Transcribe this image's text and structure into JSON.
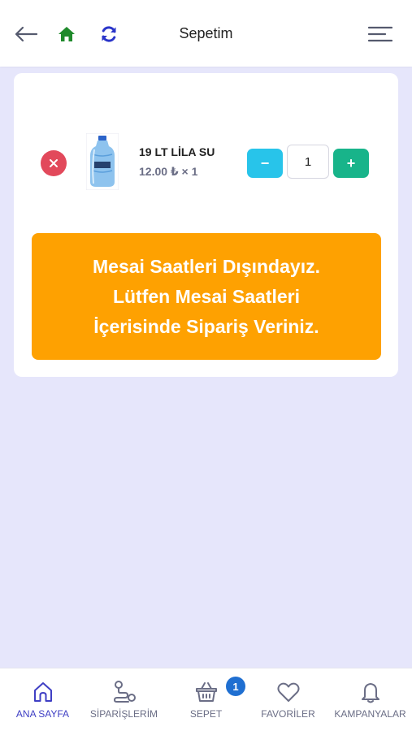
{
  "header": {
    "title": "Sepetim",
    "icons": [
      "back-arrow-icon",
      "home-icon",
      "refresh-icon",
      "hamburger-menu-icon"
    ],
    "home_color": "#1f8a2b",
    "refresh_color": "#2a35c9"
  },
  "cart": {
    "items": [
      {
        "name": "19 LT LİLA SU",
        "price_line": "12.00 ₺ × 1",
        "quantity": "1",
        "minus_label": "−",
        "plus_label": "+"
      }
    ],
    "remove_color": "#e2495b",
    "minus_color": "#28c4ea",
    "plus_color": "#18b48a"
  },
  "notice": {
    "lines": [
      "Mesai Saatleri Dışındayız.",
      "Lütfen Mesai Saatleri",
      "İçerisinde Sipariş Veriniz."
    ],
    "background": "#fea101"
  },
  "bottom_nav": {
    "items": [
      {
        "label": "ANA SAYFA",
        "icon": "home-outline-icon",
        "active": true
      },
      {
        "label": "SİPARİŞLERİM",
        "icon": "route-icon",
        "active": false
      },
      {
        "label": "SEPET",
        "icon": "basket-icon",
        "active": false
      },
      {
        "label": "FAVORİLER",
        "icon": "heart-icon",
        "active": false
      },
      {
        "label": "KAMPANYALAR",
        "icon": "bell-icon",
        "active": false
      }
    ],
    "cart_badge": "1",
    "active_color": "#3f3fc4"
  }
}
